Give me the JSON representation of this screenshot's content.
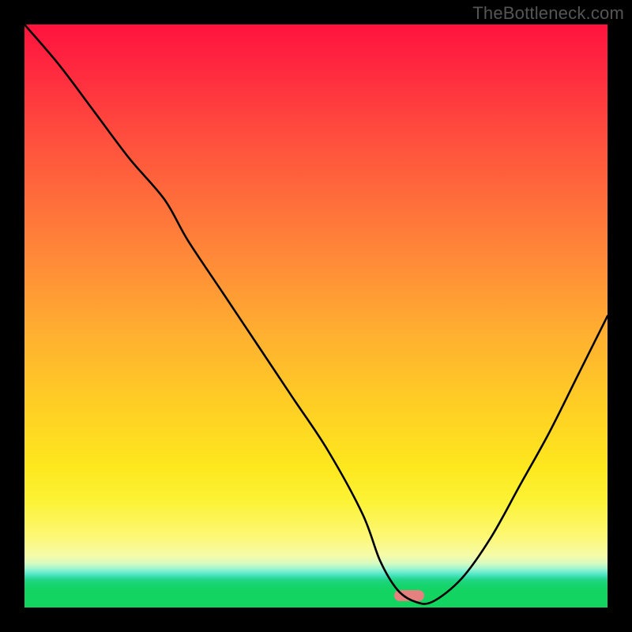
{
  "watermark": "TheBottleneck.com",
  "chart_data": {
    "type": "line",
    "title": "",
    "xlabel": "",
    "ylabel": "",
    "xlim": [
      0,
      100
    ],
    "ylim": [
      0,
      100
    ],
    "grid": false,
    "legend": false,
    "background_gradient": {
      "direction": "vertical",
      "stops": [
        {
          "pos": 0.0,
          "color": "#ff133e"
        },
        {
          "pos": 0.18,
          "color": "#ff4a3e"
        },
        {
          "pos": 0.42,
          "color": "#ff8f37"
        },
        {
          "pos": 0.66,
          "color": "#ffd024"
        },
        {
          "pos": 0.82,
          "color": "#fcf337"
        },
        {
          "pos": 0.91,
          "color": "#f6fba8"
        },
        {
          "pos": 0.945,
          "color": "#54e6c4"
        },
        {
          "pos": 0.97,
          "color": "#13d463"
        },
        {
          "pos": 1.0,
          "color": "#11d45e"
        }
      ]
    },
    "series": [
      {
        "name": "bottleneck-curve",
        "color": "#000000",
        "x": [
          0,
          6,
          12,
          18,
          24,
          28,
          34,
          40,
          46,
          52,
          58,
          61,
          64,
          67,
          70,
          75,
          80,
          85,
          90,
          95,
          100
        ],
        "y": [
          100,
          93,
          85,
          77,
          70,
          63,
          54,
          45,
          36,
          27,
          16,
          8,
          3,
          1,
          1,
          5,
          12,
          21,
          30,
          40,
          50
        ]
      }
    ],
    "annotations": [
      {
        "name": "optimal-marker",
        "shape": "pill",
        "color": "#e5817f",
        "x": 66,
        "y": 2
      }
    ]
  }
}
